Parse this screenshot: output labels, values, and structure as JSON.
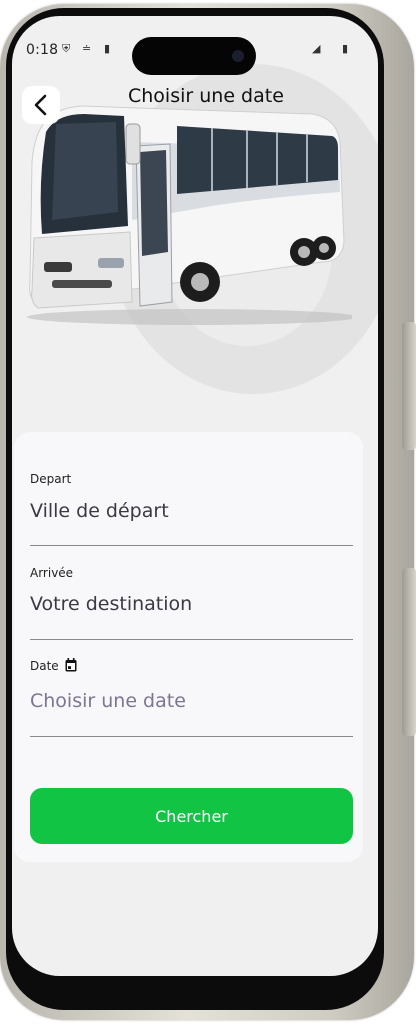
{
  "status": {
    "time": "0:18"
  },
  "header": {
    "title": "Choisir une date",
    "back_icon": "chevron-left-icon"
  },
  "form": {
    "depart": {
      "label": "Depart",
      "value": "Ville de départ"
    },
    "arrivee": {
      "label": "Arrivée",
      "value": "Votre destination"
    },
    "date": {
      "label": "Date",
      "value": "Choisir une date",
      "icon": "calendar-icon"
    }
  },
  "search": {
    "label": "Chercher"
  },
  "colors": {
    "accent": "#12c443",
    "date_value": "#7d7592",
    "background": "#f0f0f0"
  }
}
